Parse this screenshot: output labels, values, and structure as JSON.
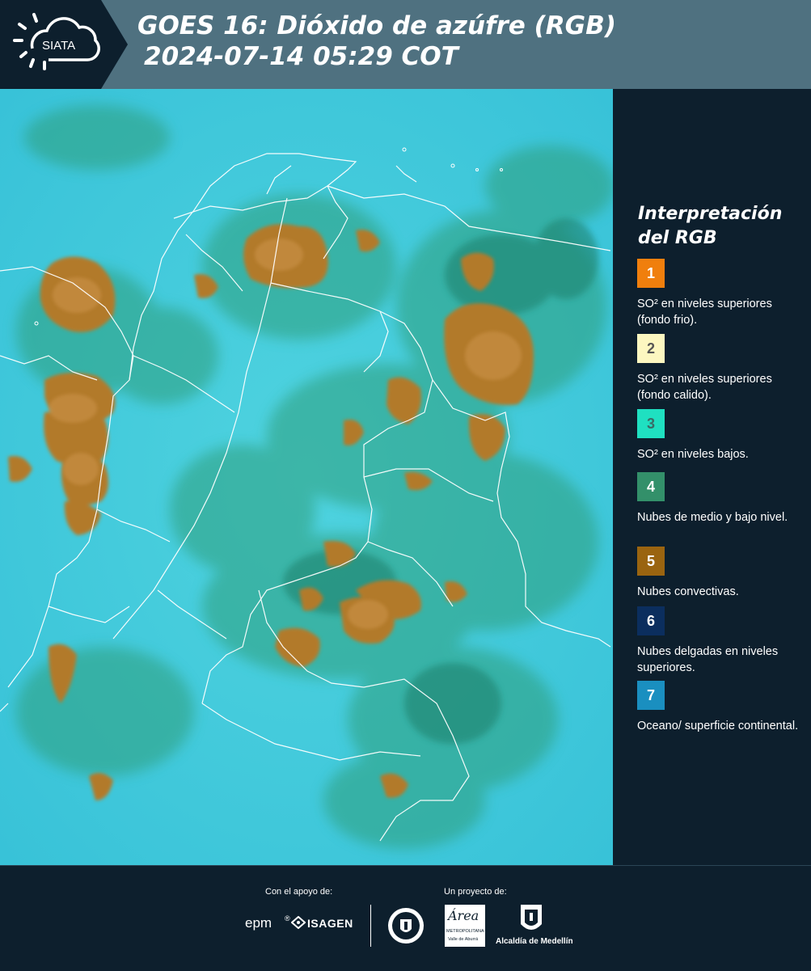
{
  "header": {
    "brand": "SIATA",
    "title_line1": "GOES 16: Dióxido de azúfre (RGB)",
    "title_line2": "2024-07-14 05:29 COT",
    "bg_color": "#4f7180"
  },
  "legend": {
    "title": "Interpretación del RGB",
    "items": [
      {
        "number": "1",
        "color": "#f07f0d",
        "text_color": "#ffffff",
        "label": "SO² en niveles superiores (fondo frio)."
      },
      {
        "number": "2",
        "color": "#fcf7c0",
        "text_color": "#555555",
        "label": "SO² en niveles superiores (fondo calido)."
      },
      {
        "number": "3",
        "color": "#1fe0c1",
        "text_color": "#3a6b66",
        "label": "SO² en niveles bajos."
      },
      {
        "number": "4",
        "color": "#33906a",
        "text_color": "#ffffff",
        "label": "Nubes de medio y bajo nivel."
      },
      {
        "number": "5",
        "color": "#9a6410",
        "text_color": "#ffffff",
        "label": "Nubes convectivas."
      },
      {
        "number": "6",
        "color": "#0b2e5e",
        "text_color": "#ffffff",
        "label": "Nubes delgadas en niveles superiores."
      },
      {
        "number": "7",
        "color": "#1a8fc0",
        "text_color": "#ffffff",
        "label": "Oceano/ superficie continental."
      }
    ]
  },
  "footer": {
    "support_label": "Con el apoyo de:",
    "project_label": "Un proyecto de:",
    "epm": "epm",
    "isagen": "ISAGEN",
    "area_brand": "Área",
    "area_sub": "METROPOLITANA",
    "area_sub2": "Valle de Aburrá",
    "alcaldia": "Alcaldía de Medellín"
  }
}
